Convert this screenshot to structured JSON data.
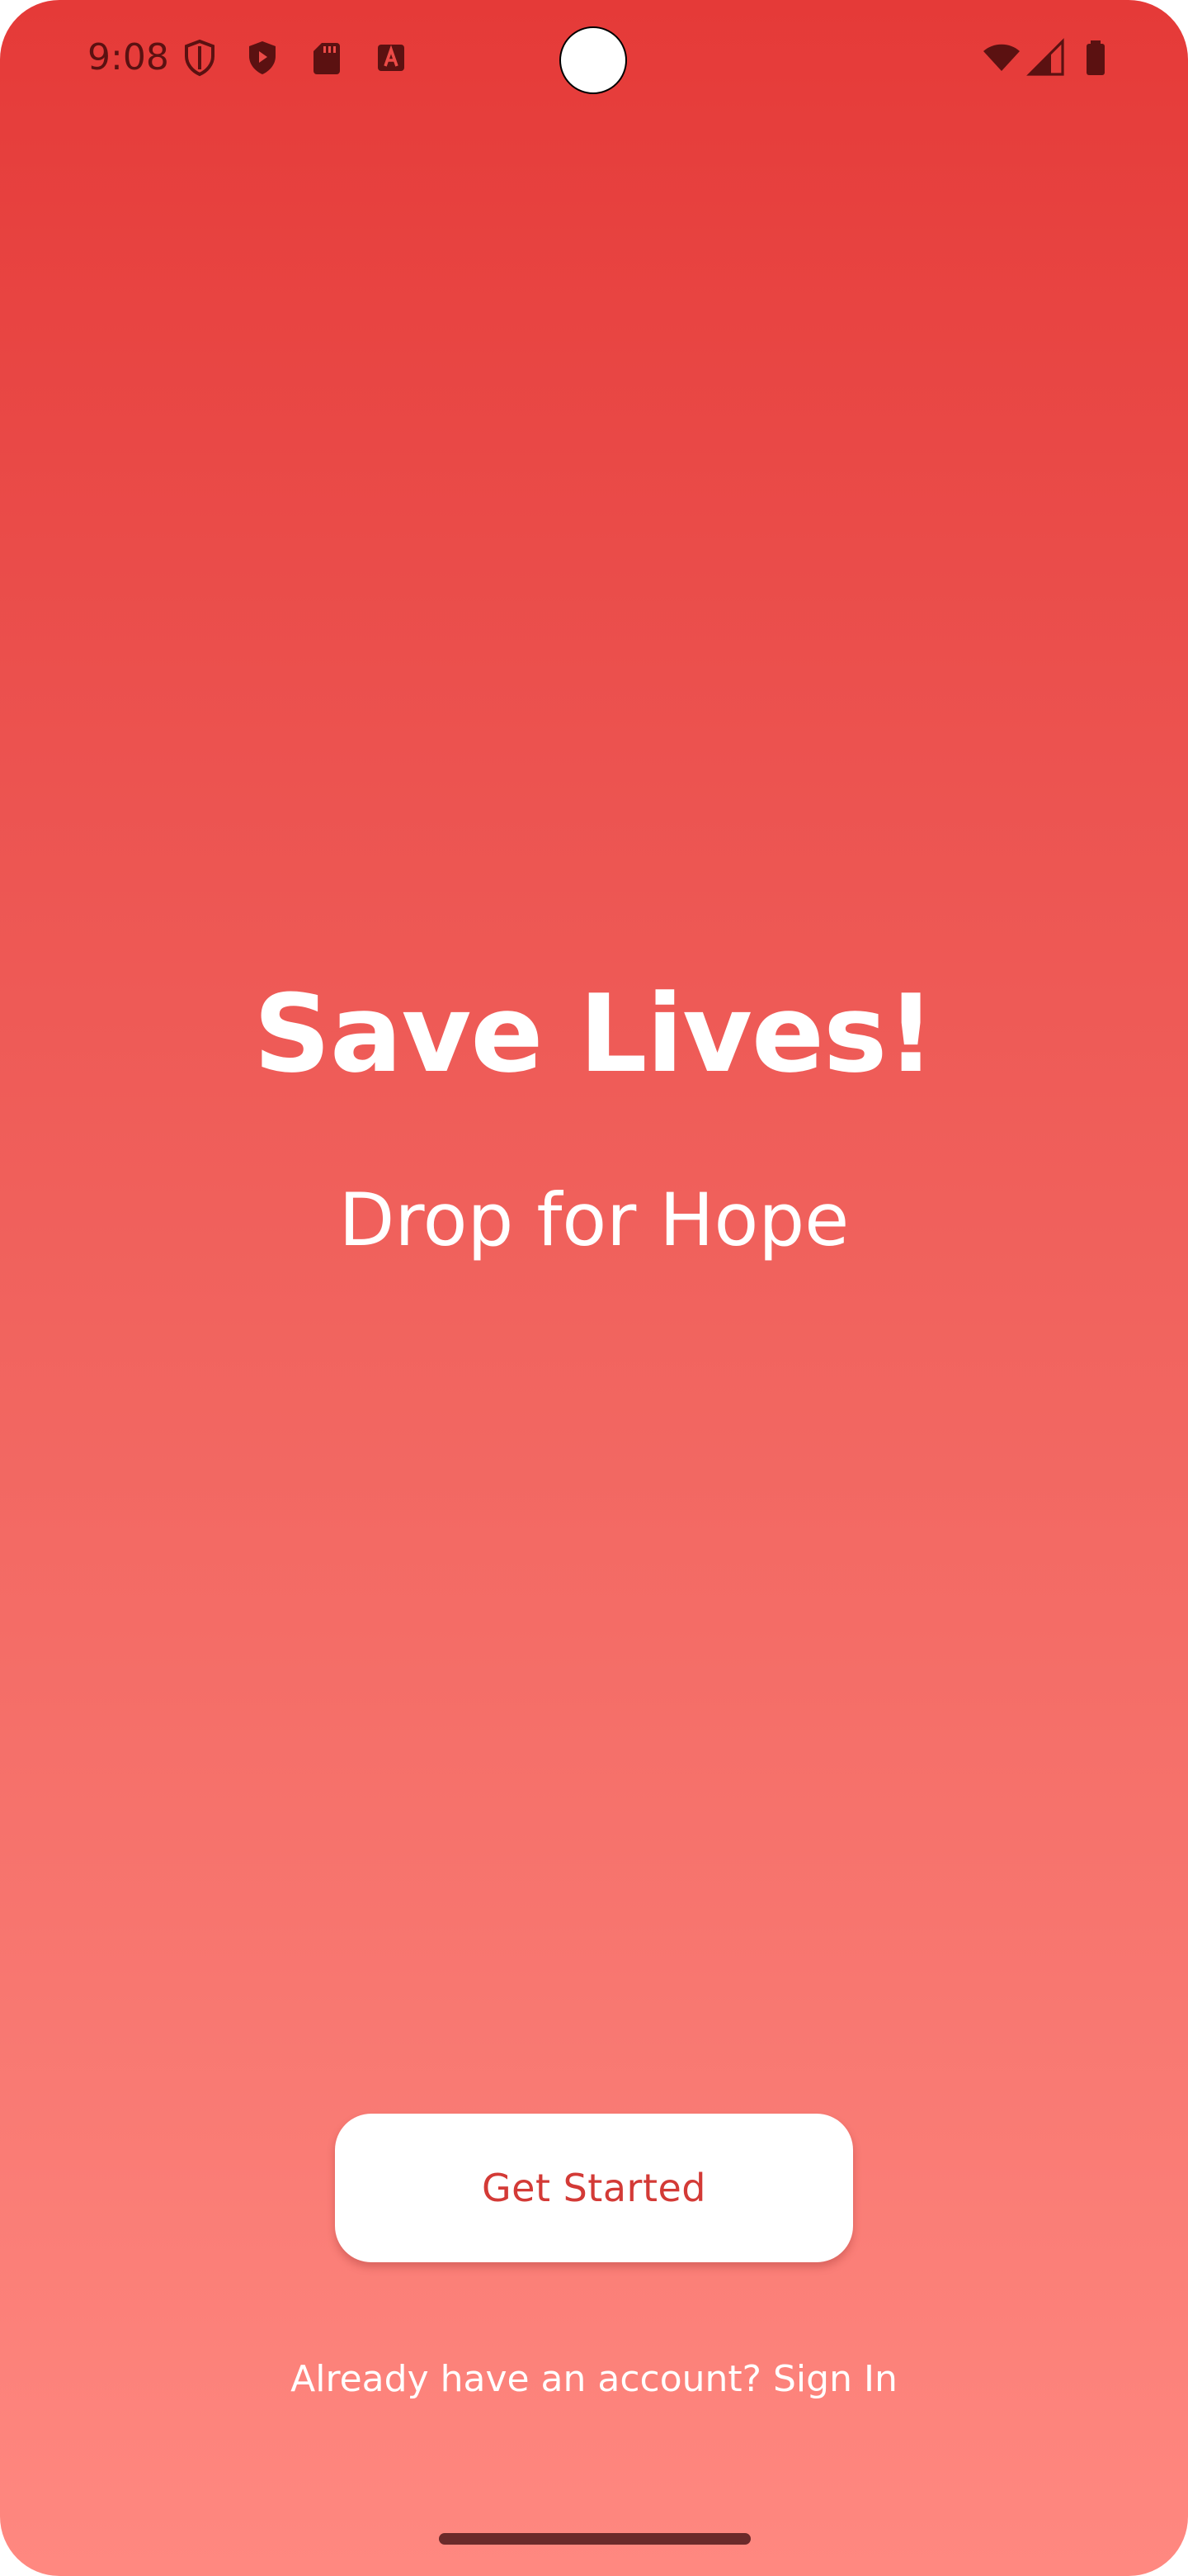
{
  "status_bar": {
    "time": "9:08",
    "icons": [
      "shield-outline-icon",
      "play-shield-icon",
      "sd-card-icon",
      "font-a-icon",
      "wifi-icon",
      "cell-signal-icon",
      "battery-icon"
    ]
  },
  "hero": {
    "title": "Save Lives!",
    "subtitle": "Drop for Hope"
  },
  "actions": {
    "get_started_label": "Get Started",
    "sign_in_prompt": "Already have an account? Sign In"
  },
  "colors": {
    "gradient_top": "#e53a38",
    "gradient_bottom": "#ff8880",
    "button_text": "#d33a36",
    "status_icons": "#5b1111"
  }
}
